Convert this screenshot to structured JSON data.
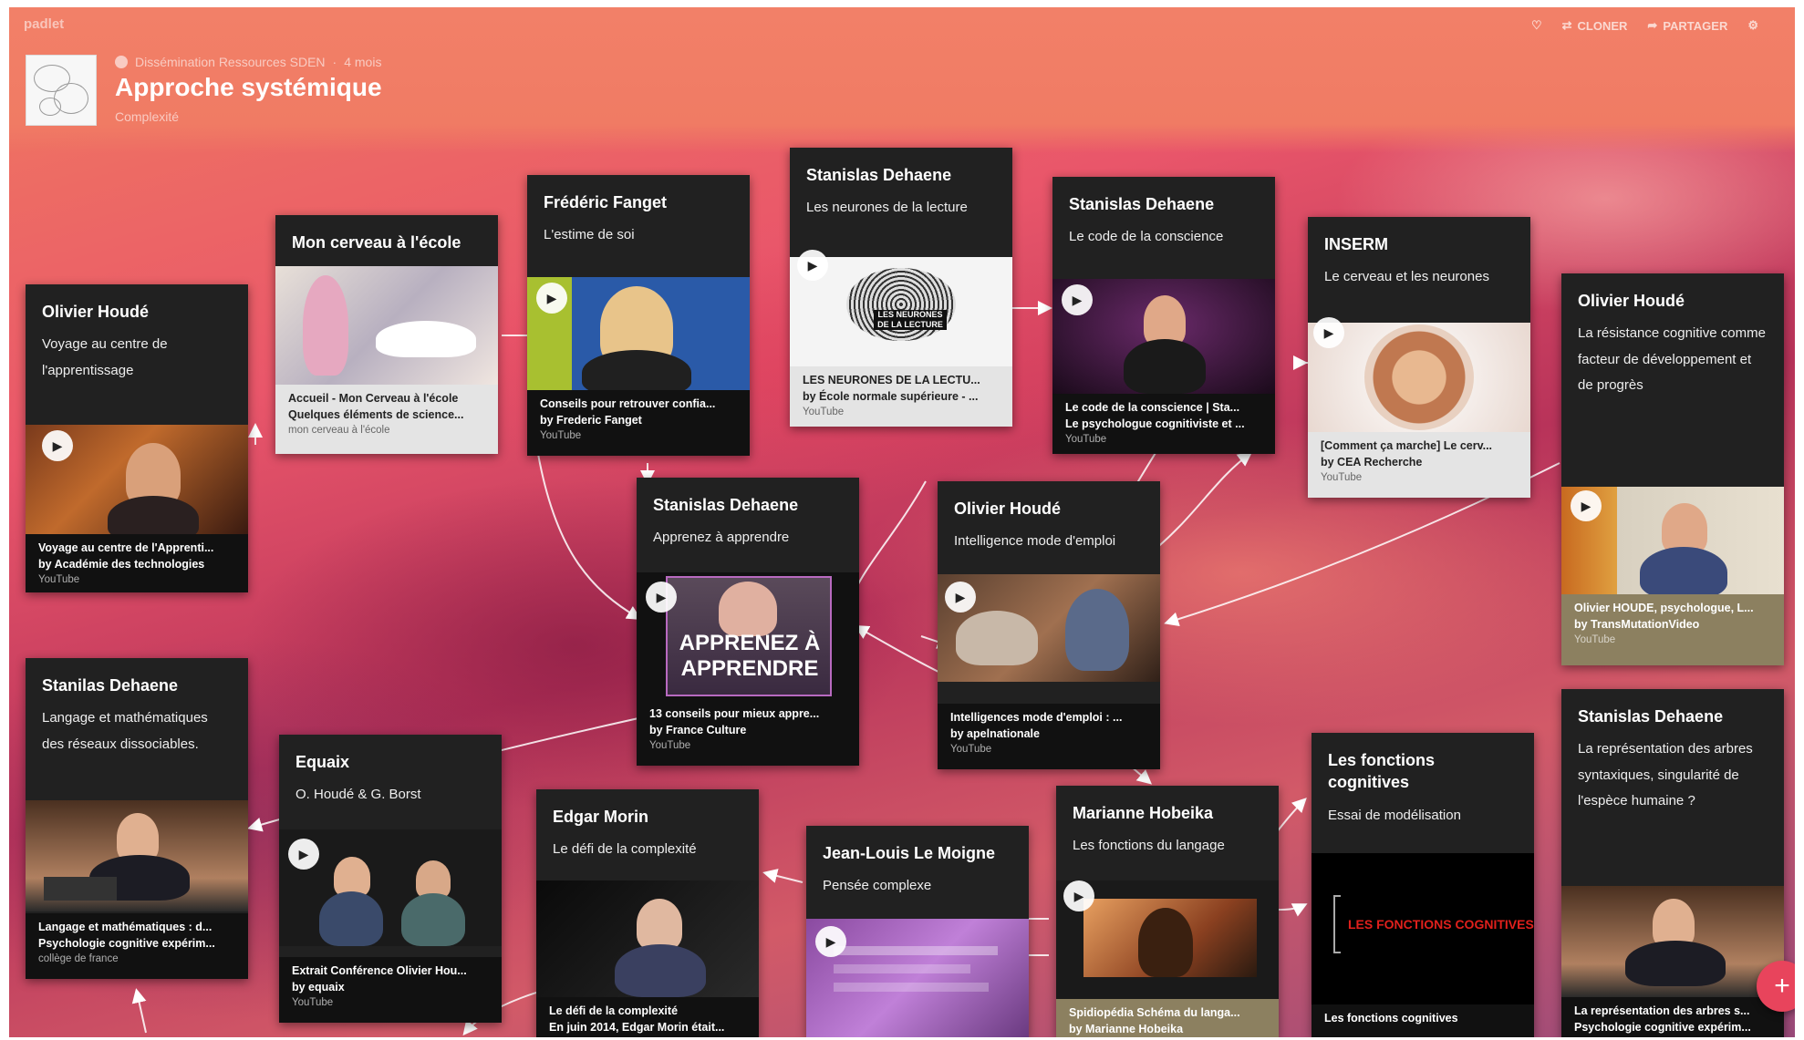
{
  "app": {
    "brand": "padlet"
  },
  "header": {
    "breadcrumb_author": "Dissémination Ressources SDEN",
    "breadcrumb_sep": "·",
    "breadcrumb_time": "4 mois",
    "title": "Approche systémique",
    "subtitle": "Complexité",
    "actions": {
      "remake": "CLONER",
      "share": "PARTAGER"
    }
  },
  "cards": {
    "houde1": {
      "title": "Olivier Houdé",
      "body": "Voyage au centre de l'apprentissage",
      "cap1": "Voyage au centre de l'Apprenti...",
      "cap2": "by Académie des technologies",
      "cap3": "YouTube"
    },
    "cerveau": {
      "title": "Mon cerveau à l'école",
      "cap1": "Accueil - Mon Cerveau à l'école",
      "cap2": "Quelques éléments de science...",
      "cap3": "mon cerveau à l'école"
    },
    "fanget": {
      "title": "Frédéric Fanget",
      "body": "L'estime de soi",
      "cap1": "Conseils pour retrouver confia...",
      "cap2": "by Frederic Fanget",
      "cap3": "YouTube"
    },
    "dehaene_lecture": {
      "title": "Stanislas Dehaene",
      "body": "Les neurones de la lecture",
      "img_text": "LES NEURONES DE LA LECTURE",
      "cap1": "LES NEURONES DE LA LECTU...",
      "cap2": "by École normale supérieure - ...",
      "cap3": "YouTube"
    },
    "dehaene_conscience": {
      "title": "Stanislas Dehaene",
      "body": "Le code de la conscience",
      "cap1": "Le code de la conscience | Sta...",
      "cap2": "Le psychologue cognitiviste et ...",
      "cap3": "YouTube"
    },
    "inserm": {
      "title": "INSERM",
      "body": "Le cerveau et les neurones",
      "cap1": "[Comment ça marche] Le cerv...",
      "cap2": "by CEA Recherche",
      "cap3": "YouTube"
    },
    "houde_resistance": {
      "title": "Olivier Houdé",
      "body": "La résistance cognitive comme facteur de développement et de progrès",
      "cap1": "Olivier HOUDE, psychologue, L...",
      "cap2": "by TransMutationVideo",
      "cap3": "YouTube"
    },
    "dehaene_apprendre": {
      "title": "Stanislas Dehaene",
      "body": "Apprenez à apprendre",
      "img_text": "APPRENEZ À APPRENDRE",
      "cap1": "13 conseils pour mieux appre...",
      "cap2": "by France Culture",
      "cap3": "YouTube"
    },
    "houde_intelligence": {
      "title": "Olivier Houdé",
      "body": "Intelligence mode d'emploi",
      "cap1": "Intelligences mode d'emploi : ...",
      "cap2": "by apelnationale",
      "cap3": "YouTube"
    },
    "dehaene_langage": {
      "title": "Stanilas Dehaene",
      "body": "Langage et mathématiques des réseaux dissociables.",
      "cap1": "Langage et mathématiques : d...",
      "cap2": "Psychologie cognitive expérim...",
      "cap3": "collège de france"
    },
    "equaix": {
      "title": "Equaix",
      "body": "O. Houdé & G. Borst",
      "cap1": "Extrait Conférence Olivier Hou...",
      "cap2": "by equaix",
      "cap3": "YouTube"
    },
    "morin": {
      "title": "Edgar Morin",
      "body": "Le défi de la complexité",
      "cap1": "Le défi de la complexité",
      "cap2": "En juin 2014, Edgar Morin était..."
    },
    "lemoigne": {
      "title": "Jean-Louis Le Moigne",
      "body": "Pensée complexe"
    },
    "hobeika": {
      "title": "Marianne Hobeika",
      "body": "Les fonctions du langage",
      "cap1": "Spidiopédia Schéma du langa...",
      "cap2": "by Marianne Hobeika"
    },
    "fonctions": {
      "title": "Les fonctions cognitives",
      "body": "Essai de modélisation",
      "img_text": "LES FONCTIONS COGNITIVES",
      "cap1": "Les fonctions cognitives"
    },
    "dehaene_arbres": {
      "title": "Stanislas Dehaene",
      "body": "La représentation des arbres syntaxiques, singularité de l'espèce humaine ?",
      "cap1": "La représentation des arbres s...",
      "cap2": "Psychologie cognitive expérim..."
    }
  },
  "colors": {
    "header": "#f07b64",
    "card": "#212121",
    "fab": "#e8445c"
  }
}
